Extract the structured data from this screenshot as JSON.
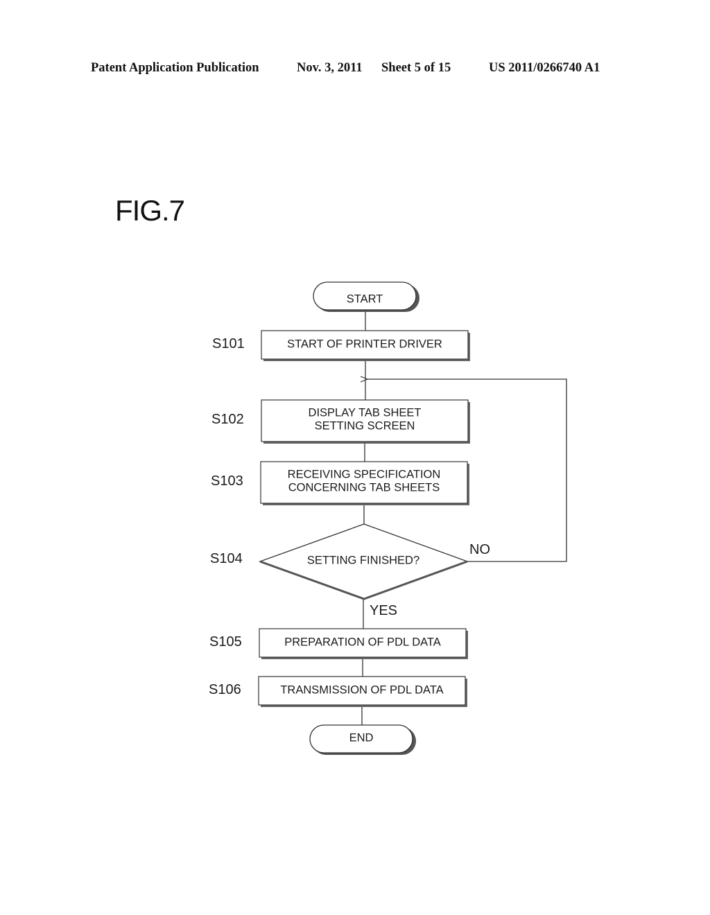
{
  "header": {
    "publication": "Patent Application Publication",
    "date": "Nov. 3, 2011",
    "sheet": "Sheet 5 of 15",
    "number": "US 2011/0266740 A1"
  },
  "figure": {
    "title": "FIG.7",
    "start_label": "START",
    "end_label": "END",
    "steps": [
      {
        "id": "S101",
        "lines": [
          "START OF PRINTER DRIVER"
        ]
      },
      {
        "id": "S102",
        "lines": [
          "DISPLAY TAB SHEET",
          "SETTING SCREEN"
        ]
      },
      {
        "id": "S103",
        "lines": [
          "RECEIVING SPECIFICATION",
          "CONCERNING TAB SHEETS"
        ]
      },
      {
        "id": "S104",
        "lines": [
          "SETTING FINISHED?"
        ],
        "type": "decision"
      },
      {
        "id": "S105",
        "lines": [
          "PREPARATION OF PDL DATA"
        ]
      },
      {
        "id": "S106",
        "lines": [
          "TRANSMISSION OF PDL DATA"
        ]
      }
    ],
    "decision_yes": "YES",
    "decision_no": "NO"
  }
}
